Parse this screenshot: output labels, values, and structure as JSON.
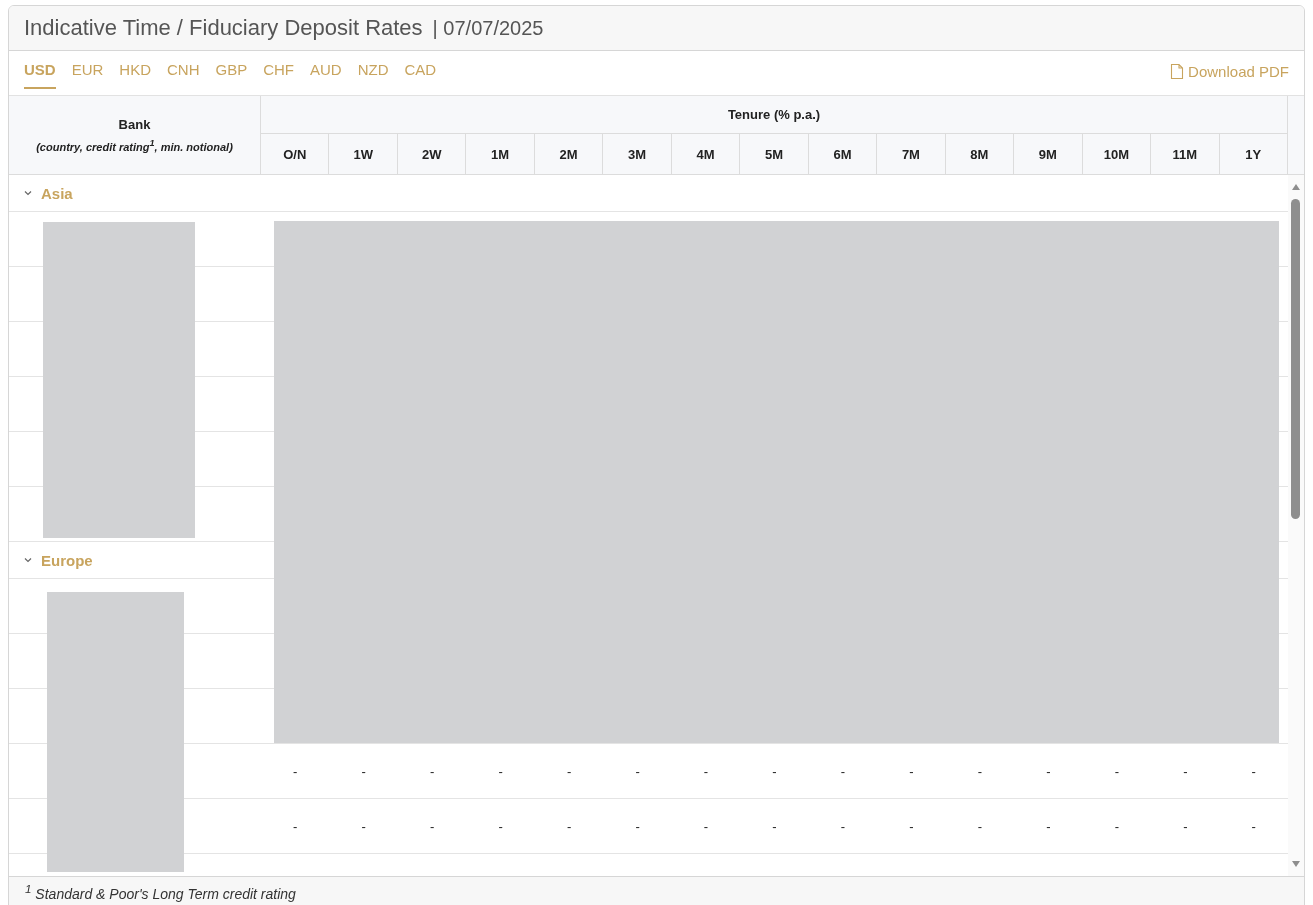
{
  "title": "Indicative Time / Fiduciary Deposit Rates",
  "date": "| 07/07/2025",
  "tabs": [
    {
      "label": "USD",
      "selected": true
    },
    {
      "label": "EUR",
      "selected": false
    },
    {
      "label": "HKD",
      "selected": false
    },
    {
      "label": "CNH",
      "selected": false
    },
    {
      "label": "GBP",
      "selected": false
    },
    {
      "label": "CHF",
      "selected": false
    },
    {
      "label": "AUD",
      "selected": false
    },
    {
      "label": "NZD",
      "selected": false
    },
    {
      "label": "CAD",
      "selected": false
    }
  ],
  "download": "Download PDF",
  "table": {
    "bank_heading": "Bank",
    "bank_subheading": "(country, credit rating$^{1}$, min. notional)",
    "tenure_heading": "Tenure (% p.a.)",
    "columns": [
      "O/N",
      "1W",
      "2W",
      "1M",
      "2M",
      "3M",
      "4M",
      "5M",
      "6M",
      "7M",
      "8M",
      "9M",
      "10M",
      "11M",
      "1Y"
    ],
    "groups": [
      {
        "label": "Asia",
        "expanded": true,
        "rows": [
          {
            "redacted": true
          },
          {
            "redacted": true
          },
          {
            "redacted": true
          },
          {
            "redacted": true
          },
          {
            "redacted": true
          },
          {
            "redacted": true
          }
        ]
      },
      {
        "label": "Europe",
        "expanded": true,
        "rows": [
          {
            "redacted": true
          },
          {
            "redacted": true
          },
          {
            "redacted": true
          },
          {
            "redacted": false,
            "cells": [
              "-",
              "-",
              "-",
              "-",
              "-",
              "-",
              "-",
              "-",
              "-",
              "-",
              "-",
              "-",
              "-",
              "-",
              "-"
            ]
          },
          {
            "redacted": false,
            "cells": [
              "-",
              "-",
              "-",
              "-",
              "-",
              "-",
              "-",
              "-",
              "-",
              "-",
              "-",
              "-",
              "-",
              "-",
              "-"
            ]
          }
        ]
      }
    ]
  },
  "footnote": "$^{1}$ Standard & Poor's Long Term credit rating"
}
